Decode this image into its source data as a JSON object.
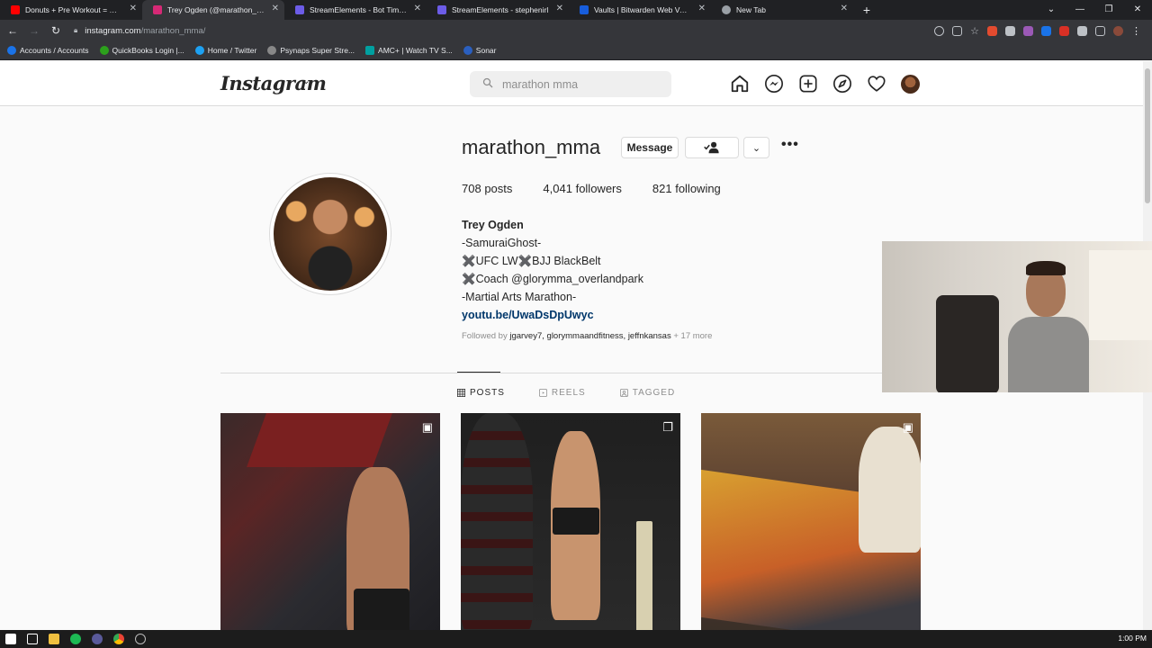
{
  "browser": {
    "tabs": [
      {
        "label": "Donuts + Pre Workout = GIT 'R' ...",
        "color": "#ff0000",
        "active": false
      },
      {
        "label": "Trey Ogden (@marathon_mma)",
        "color": "#d62976",
        "active": true
      },
      {
        "label": "StreamElements - Bot Timers",
        "color": "#6c5ce7",
        "active": false
      },
      {
        "label": "StreamElements - stephenirl",
        "color": "#6c5ce7",
        "active": false
      },
      {
        "label": "Vaults | Bitwarden Web Vault",
        "color": "#175ddc",
        "active": false
      },
      {
        "label": "New Tab",
        "color": "#9aa0a6",
        "active": false
      }
    ],
    "url_host": "instagram.com",
    "url_path": "/marathon_mma/",
    "bookmarks": [
      {
        "label": "Accounts / Accounts",
        "color": "#1a73e8"
      },
      {
        "label": "QuickBooks Login |...",
        "color": "#2ca01c"
      },
      {
        "label": "Home / Twitter",
        "color": "#1da1f2"
      },
      {
        "label": "Psynaps Super Stre...",
        "color": "#888888"
      },
      {
        "label": "AMC+ | Watch TV S...",
        "color": "#00a0a0"
      },
      {
        "label": "Sonar",
        "color": "#2a5fbf"
      }
    ]
  },
  "instagram": {
    "logo": "Instagram",
    "search_value": "marathon mma",
    "profile": {
      "username": "marathon_mma",
      "message_label": "Message",
      "stats": {
        "posts_count": "708",
        "posts_label": "posts",
        "followers_count": "4,041",
        "followers_label": "followers",
        "following_count": "821",
        "following_label": "following"
      },
      "name": "Trey Ogden",
      "bio": [
        "-SamuraiGhost-",
        "✖️UFC LW✖️BJJ BlackBelt",
        "✖️Coach @glorymma_overlandpark",
        "-Martial Arts Marathon-"
      ],
      "link": "youtu.be/UwaDsDpUwyc",
      "followed_prefix": "Followed by",
      "followed_users": "jgarvey7, glorymmaandfitness, jeffnkansas",
      "followed_more": "+ 17 more"
    },
    "tabs": [
      {
        "label": "POSTS",
        "active": true
      },
      {
        "label": "REELS",
        "active": false
      },
      {
        "label": "TAGGED",
        "active": false
      }
    ]
  },
  "taskbar": {
    "clock": "1:00 PM"
  }
}
